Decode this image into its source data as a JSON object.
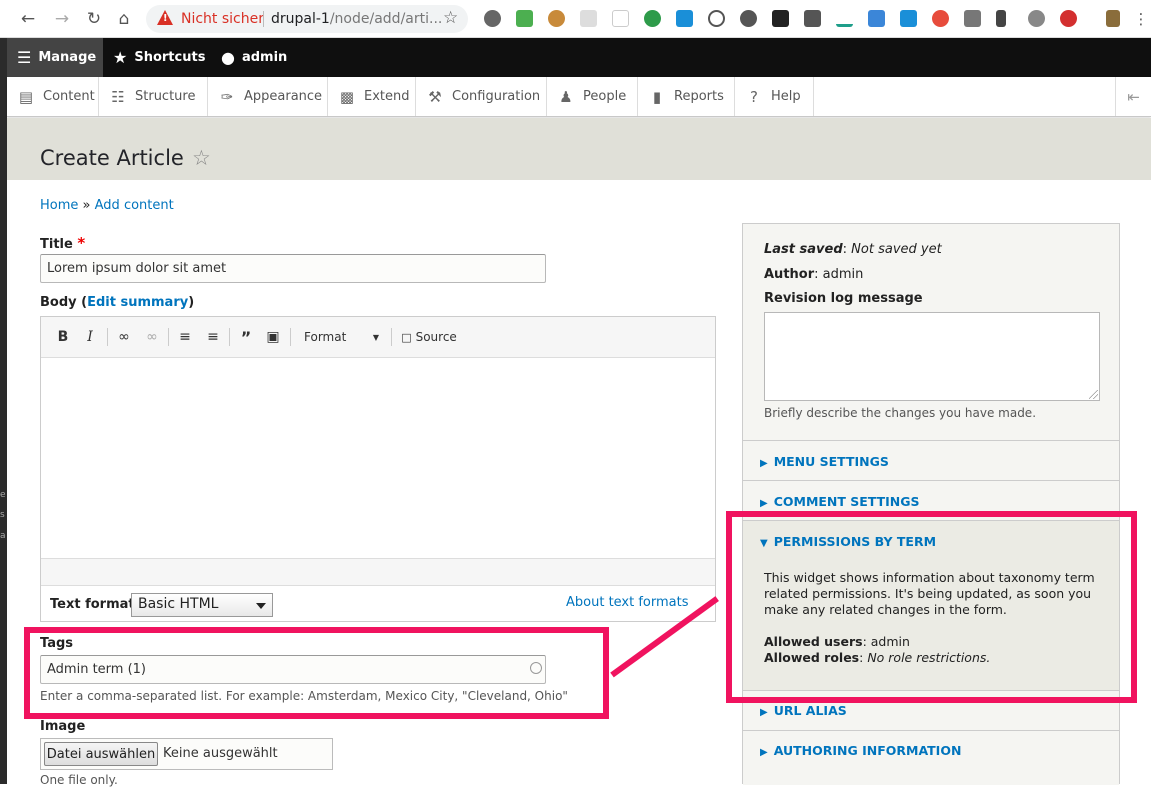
{
  "browser": {
    "security_label": "Nicht sicher",
    "url_host": "drupal-1",
    "url_path": "/node/add/arti..."
  },
  "toolbar": {
    "manage": "Manage",
    "shortcuts": "Shortcuts",
    "user": "admin"
  },
  "tray": {
    "items": [
      "Content",
      "Structure",
      "Appearance",
      "Extend",
      "Configuration",
      "People",
      "Reports",
      "Help"
    ]
  },
  "page": {
    "title": "Create Article",
    "breadcrumb_home": "Home",
    "breadcrumb_sep": "»",
    "breadcrumb_current": "Add content"
  },
  "form": {
    "title_label": "Title",
    "title_value": "Lorem ipsum dolor sit amet",
    "body_label": "Body (",
    "body_edit_summary": "Edit summary",
    "body_label_end": ")",
    "editor_format_dropdown": "Format",
    "editor_source": "Source",
    "text_format_label": "Text format",
    "text_format_value": "Basic HTML",
    "about_text_formats": "About text formats",
    "tags_label": "Tags",
    "tags_value": "Admin term (1)",
    "tags_description": "Enter a comma-separated list. For example: Amsterdam, Mexico City, \"Cleveland, Ohio\"",
    "image_label": "Image",
    "file_button": "Datei auswählen",
    "file_status": "Keine ausgewählt",
    "file_hint": "One file only."
  },
  "sidebar": {
    "last_saved_label": "Last saved",
    "last_saved_value": "Not saved yet",
    "author_label": "Author",
    "author_value": "admin",
    "revision_label": "Revision log message",
    "revision_description": "Briefly describe the changes you have made.",
    "menu_settings": "Menu settings",
    "comment_settings": "Comment settings",
    "permissions_by_term": "Permissions by term",
    "permissions_text": "This widget shows information about taxonomy term related permissions. It's being updated, as soon you make any related changes in the form.",
    "allowed_users_label": "Allowed users",
    "allowed_users_value": "admin",
    "allowed_roles_label": "Allowed roles",
    "allowed_roles_value": "No role restrictions.",
    "url_alias": "URL alias",
    "authoring_information": "Authoring information"
  },
  "colors": {
    "link": "#0074bd",
    "highlight": "#f0135f",
    "toolbar_bg": "#0f0f0f"
  }
}
